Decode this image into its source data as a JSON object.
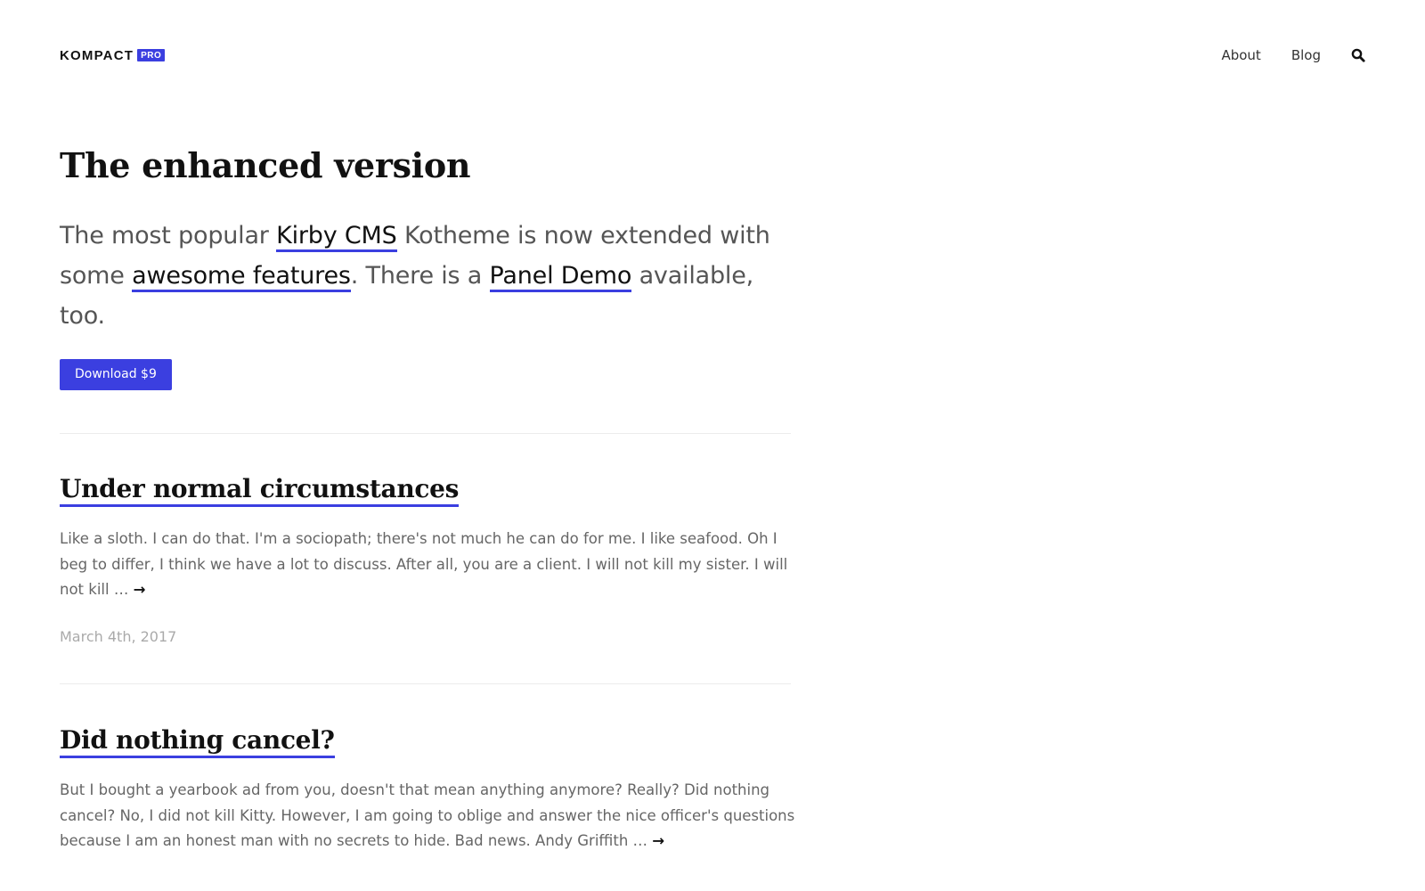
{
  "header": {
    "logo_text": "KOMPACT",
    "logo_badge": "PRO",
    "nav": {
      "about": "About",
      "blog": "Blog"
    },
    "search_icon": "search-icon"
  },
  "hero": {
    "title": "The enhanced version",
    "lead": {
      "part1": "The most popular ",
      "link1": "Kirby CMS",
      "part2": " Kotheme is now extended with some ",
      "link2": "awesome features",
      "part3": ". There is a ",
      "link3": "Panel Demo",
      "part4": " available, too."
    },
    "button_label": "Download $9"
  },
  "posts": [
    {
      "title": "Under normal circumstances",
      "excerpt": "Like a sloth. I can do that. I'm a sociopath; there's not much he can do for me. I like seafood. Oh I beg to differ, I think we have a lot to discuss. After all, you are a client. I will not kill my sister. I will not kill … ",
      "arrow": "→",
      "date": "March 4th, 2017"
    },
    {
      "title": "Did nothing cancel?",
      "excerpt": "But I bought a yearbook ad from you, doesn't that mean anything anymore? Really? Did nothing cancel? No, I did not kill Kitty. However, I am going to oblige and answer the nice officer's questions because I am an honest man with no secrets to hide. Bad news. Andy Griffith … ",
      "arrow": "→"
    }
  ],
  "colors": {
    "accent": "#3b3fe0",
    "text": "#111111",
    "muted": "#666666",
    "date": "#aaaaaa"
  }
}
